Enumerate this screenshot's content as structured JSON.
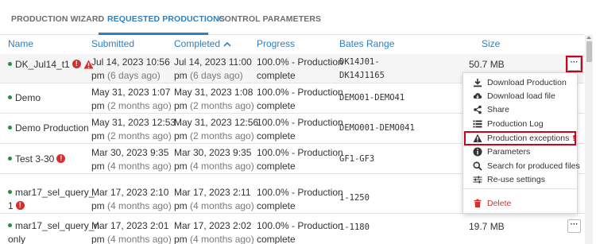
{
  "tabs": [
    {
      "label": "PRODUCTION WIZARD"
    },
    {
      "label": "REQUESTED PRODUCTIONS"
    },
    {
      "label": "CONTROL PARAMETERS"
    }
  ],
  "columns": {
    "name": "Name",
    "submitted": "Submitted",
    "completed": "Completed",
    "progress": "Progress",
    "bates": "Bates Range",
    "size": "Size"
  },
  "rows": [
    {
      "name": "DK_Jul14_t1",
      "sub_date": "Jul 14, 2023 10:56",
      "sub_time": "pm",
      "sub_ago": "(6 days ago)",
      "comp_date": "Jul 14, 2023 11:00",
      "comp_time": "pm",
      "comp_ago": "(6 days ago)",
      "progress": "100.0% - Production",
      "progress2": "complete",
      "bates1": "DK14J01-",
      "bates2": "DK14J1165",
      "size": "50.7 MB"
    },
    {
      "name": "Demo",
      "sub_date": "May 31, 2023 1:07",
      "sub_time": "pm",
      "sub_ago": "(2 months ago)",
      "comp_date": "May 31, 2023 1:08",
      "comp_time": "pm",
      "comp_ago": "(2 months ago)",
      "progress": "100.0% - Production",
      "progress2": "complete",
      "bates1": "DEMO01-DEMO41"
    },
    {
      "name": "Demo Production",
      "sub_date": "May 31, 2023 12:53",
      "sub_time": "pm",
      "sub_ago": "(2 months ago)",
      "comp_date": "May 31, 2023 12:56",
      "comp_time": "pm",
      "comp_ago": "(2 months ago)",
      "progress": "100.0% - Production",
      "progress2": "complete",
      "bates1": "DEMO001-DEMO041"
    },
    {
      "name": "Test 3-30",
      "sub_date": "Mar 30, 2023 9:35",
      "sub_time": "pm",
      "sub_ago": "(4 months ago)",
      "comp_date": "Mar 30, 2023 9:35",
      "comp_time": "pm",
      "comp_ago": "(4 months ago)",
      "progress": "100.0% - Production",
      "progress2": "complete",
      "bates1": "GF1-GF3"
    },
    {
      "name": "mar17_sel_query_",
      "name2": "1",
      "sub_date": "Mar 17, 2023 2:10",
      "sub_time": "pm",
      "sub_ago": "(4 months ago)",
      "comp_date": "Mar 17, 2023 2:11",
      "comp_time": "pm",
      "comp_ago": "(4 months ago)",
      "progress": "100.0% - Production",
      "progress2": "complete",
      "bates1": "1-1250"
    },
    {
      "name": "mar17_sel_query_n",
      "name2": "only",
      "sub_date": "Mar 17, 2023 2:01",
      "sub_time": "pm",
      "sub_ago": "(4 months ago)",
      "comp_date": "Mar 17, 2023 2:02",
      "comp_time": "pm",
      "comp_ago": "(4 months ago)",
      "progress": "100.0% - Production",
      "progress2": "complete",
      "bates1": "1-1180",
      "size": "19.7 MB"
    }
  ],
  "menu": {
    "download_production": "Download Production",
    "download_load_file": "Download load file",
    "share": "Share",
    "production_log": "Production Log",
    "production_exceptions": "Production exceptions",
    "exceptions_mark": "!",
    "parameters": "Parameters",
    "search_produced": "Search for produced files",
    "reuse_settings": "Re-use settings",
    "delete": "Delete"
  },
  "more_label": "···",
  "error_glyph": "!",
  "colors": {
    "accent": "#2f7fc1",
    "error": "#d32f2f",
    "highlight": "#d0021b",
    "success_dot": "#2e8b3d"
  }
}
